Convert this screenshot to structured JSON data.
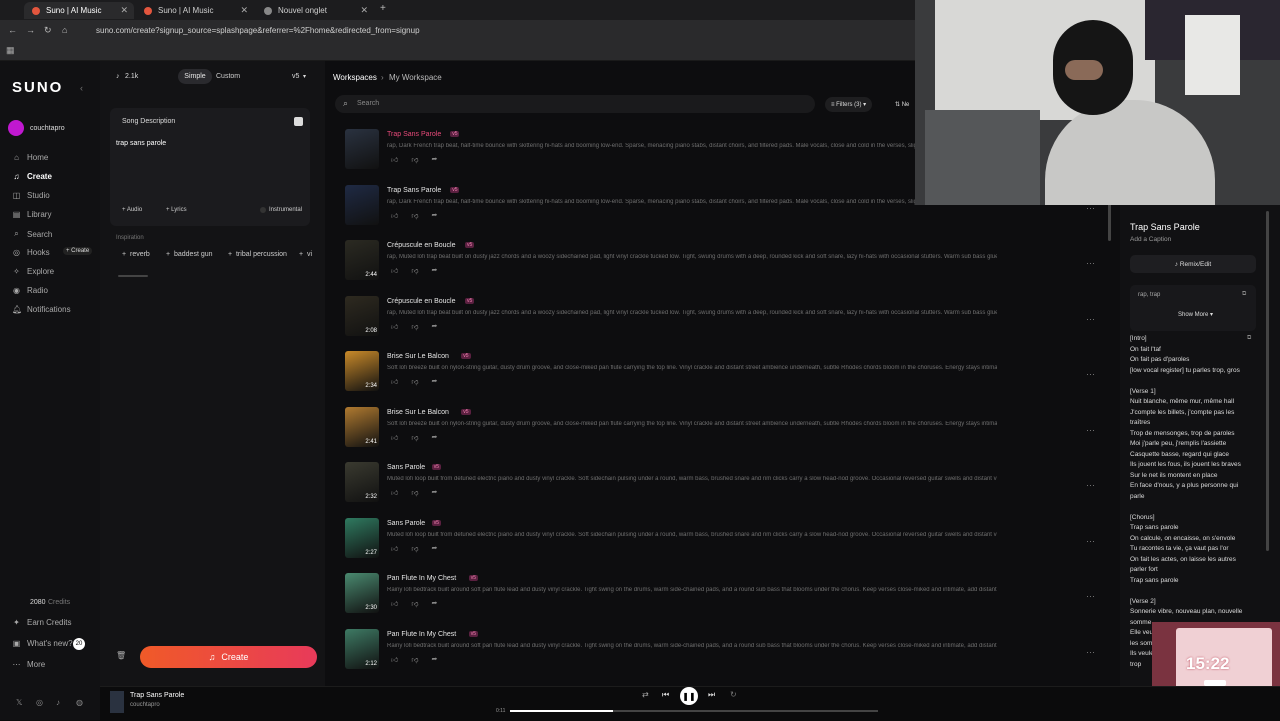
{
  "browser": {
    "tabs": [
      {
        "label": "Suno | AI Music"
      },
      {
        "label": "Suno | AI Music"
      },
      {
        "label": "Nouvel onglet"
      }
    ],
    "url": "suno.com/create?signup_source=splashpage&referrer=%2Fhome&redirected_from=signup"
  },
  "sidebar": {
    "logo": "SUNO",
    "user": "couchtapro",
    "items": [
      {
        "label": "Home",
        "icon": "home-icon"
      },
      {
        "label": "Create",
        "icon": "create-icon"
      },
      {
        "label": "Studio",
        "icon": "studio-icon"
      },
      {
        "label": "Library",
        "icon": "library-icon"
      },
      {
        "label": "Search",
        "icon": "search-icon"
      },
      {
        "label": "Hooks",
        "icon": "hooks-icon"
      },
      {
        "label": "Explore",
        "icon": "explore-icon"
      },
      {
        "label": "Radio",
        "icon": "radio-icon"
      },
      {
        "label": "Notifications",
        "icon": "bell-icon"
      }
    ],
    "hooks_create": "+ Create",
    "credits": "2080",
    "credits_label": "Credits",
    "earn": "Earn Credits",
    "whats_new": "What's new?",
    "whats_new_badge": "20",
    "more": "More"
  },
  "create": {
    "count": "2.1k",
    "mode_simple": "Simple",
    "mode_custom": "Custom",
    "version": "v5",
    "song_desc_label": "Song Description",
    "song_desc_value": "trap sans parole",
    "audio": "Audio",
    "lyrics": "Lyrics",
    "instrumental": "Instrumental",
    "inspiration": "Inspiration",
    "chips": [
      "reverb",
      "baddest gun",
      "tribal percussion",
      "vi"
    ],
    "create_button": "Create"
  },
  "workspace": {
    "crumb_root": "Workspaces",
    "crumb_current": "My Workspace",
    "search_placeholder": "Search",
    "filters": "Filters (3)",
    "sort": "Ne",
    "rows": [
      {
        "title": "Trap Sans Parole",
        "badge": "v5",
        "duration": "",
        "desc": "rap, Dark French trap beat, half-time bounce with skittering hi-hats and booming low-end. Sparse, menacing piano stabs, distant choirs, and filtered pads. Male vocals, close and cold in the verses, slightly wider",
        "color": "#2a3240",
        "highlight": true
      },
      {
        "title": "Trap Sans Parole",
        "badge": "v5",
        "duration": "",
        "desc": "rap, Dark French trap beat, half-time bounce with skittering hi-hats and booming low-end. Sparse, menacing piano stabs, distant choirs, and filtered pads. Male vocals, close and cold in the verses, slightly wider",
        "color": "#1f2a44",
        "highlight": false
      },
      {
        "title": "Crépuscule en Boucle",
        "badge": "v5",
        "duration": "2:44",
        "desc": "rap, Muted lofi trap beat built on dusty jazz chords and a woozy sidechained pad, light vinyl crackle tucked low. Tight, swung drums with a deep, rounded kick and soft snare, lazy hi-hats with occasional stutters. Warm sub bass glues it together.",
        "color": "#2b2a22",
        "highlight": false
      },
      {
        "title": "Crépuscule en Boucle",
        "badge": "v5",
        "duration": "2:08",
        "desc": "rap, Muted lofi trap beat built on dusty jazz chords and a woozy sidechained pad, light vinyl crackle tucked low. Tight, swung drums with a deep, rounded kick and soft snare, lazy hi-hats with occasional stutters. Warm sub bass glues it together.",
        "color": "#2e2a20",
        "highlight": false
      },
      {
        "title": "Brise Sur Le Balcon",
        "badge": "v5",
        "duration": "2:34",
        "desc": "Soft lofi breeze built on nylon-string guitar, dusty drum groove, and close-miked pan flute carrying the top line. Vinyl crackle and distant street ambience underneath, subtle Rhodes chords bloom in the choruses. Energy stays intimate and loopa",
        "color": "#c98a2a",
        "highlight": false
      },
      {
        "title": "Brise Sur Le Balcon",
        "badge": "v5",
        "duration": "2:41",
        "desc": "Soft lofi breeze built on nylon-string guitar, dusty drum groove, and close-miked pan flute carrying the top line. Vinyl crackle and distant street ambience underneath, subtle Rhodes chords bloom in the choruses. Energy stays intimate and loopa",
        "color": "#b07a30",
        "highlight": false
      },
      {
        "title": "Sans Parole",
        "badge": "v5",
        "duration": "2:32",
        "desc": "Muted lofi loop built from detuned electric piano and dusty vinyl crackle. Soft sidechain pulsing under a round, warm bass, brushed snare and rim clicks carry a slow head-nod groove. Occasional reversed guitar swells and distant vocal chops s",
        "color": "#3a3a30",
        "highlight": false
      },
      {
        "title": "Sans Parole",
        "badge": "v5",
        "duration": "2:27",
        "desc": "Muted lofi loop built from detuned electric piano and dusty vinyl crackle. Soft sidechain pulsing under a round, warm bass, brushed snare and rim clicks carry a slow head-nod groove. Occasional reversed guitar swells and distant vocal chops s",
        "color": "#2f7a60",
        "highlight": false
      },
      {
        "title": "Pan Flute In My Chest",
        "badge": "v5",
        "duration": "2:30",
        "desc": "Rainy lofi bedtrack built around soft pan flute lead and dusty vinyl crackle. Tight swing on the drums, warm side-chained pads, and a round sub bass that blooms under the chorus. Keep verses close-miked and intimate, add distant reverb throw",
        "color": "#4a8a70",
        "highlight": false
      },
      {
        "title": "Pan Flute In My Chest",
        "badge": "v5",
        "duration": "2:12",
        "desc": "Rainy lofi bedtrack built around soft pan flute lead and dusty vinyl crackle. Tight swing on the drums, warm side-chained pads, and a round sub bass that blooms under the chorus. Keep verses close-miked and intimate, add distant reverb throw",
        "color": "#3e7a64",
        "highlight": false
      }
    ]
  },
  "details": {
    "title": "Trap Sans Parole",
    "caption": "Add a Caption",
    "remix": "Remix/Edit",
    "tags": "rap, trap",
    "show_more": "Show More",
    "lyrics": [
      "[Intro]",
      "On fait l'taf",
      "On fait pas d'paroles",
      "[low vocal register] tu parles trop, gros",
      "",
      "[Verse 1]",
      "Nuit blanche, même mur, même hall",
      "J'compte les billets, j'compte pas les",
      "traîtres",
      "Trop de mensonges, trop de paroles",
      "Moi j'parle peu, j'remplis l'assiette",
      "Casquette basse, regard qui glace",
      "Ils jouent les fous, ils jouent les braves",
      "Sur le net ils montent en place",
      "En face d'nous, y a plus personne qui",
      "parle",
      "",
      "[Chorus]",
      "Trap sans parole",
      "On calcule, on encaisse, on s'envole",
      "Tu racontes ta vie, ça vaut pas l'or",
      "On fait les actes, on laisse les autres",
      "parler fort",
      "Trap sans parole",
      "",
      "[Verse 2]",
      "Sonnerie vibre, nouveau plan, nouvelle",
      "somme",
      "Elle veut",
      "les som",
      "Ils veule",
      "trop"
    ]
  },
  "player": {
    "title": "Trap Sans Parole",
    "artist": "couchtapro",
    "elapsed": "0:11",
    "progress": 0.28
  },
  "timer": {
    "time": "15:22"
  },
  "colors": {
    "accent": "#e84a7a",
    "create_gradient_start": "#f05a28",
    "create_gradient_end": "#e83a5a"
  }
}
